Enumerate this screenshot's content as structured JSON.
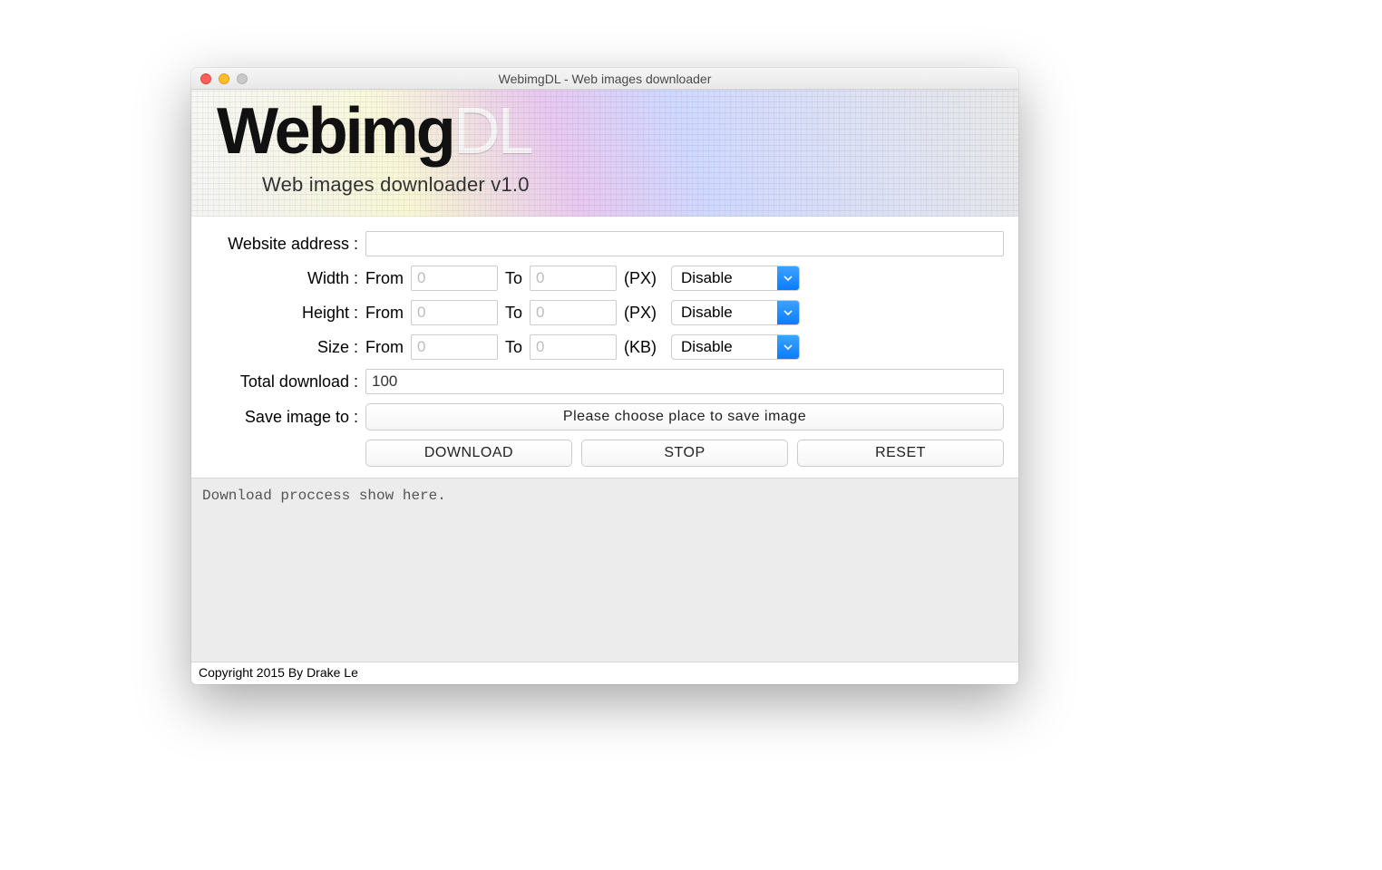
{
  "window": {
    "title": "WebimgDL - Web images downloader"
  },
  "banner": {
    "logo_main": "Webimg",
    "logo_suffix": "DL",
    "subtitle": "Web images downloader v1.0"
  },
  "form": {
    "website_label": "Website address :",
    "website_value": "",
    "width": {
      "label": "Width :",
      "from_label": "From",
      "from_placeholder": "0",
      "from_value": "",
      "to_label": "To",
      "to_placeholder": "0",
      "to_value": "",
      "unit": "(PX)",
      "select": "Disable"
    },
    "height": {
      "label": "Height :",
      "from_label": "From",
      "from_placeholder": "0",
      "from_value": "",
      "to_label": "To",
      "to_placeholder": "0",
      "to_value": "",
      "unit": "(PX)",
      "select": "Disable"
    },
    "size": {
      "label": "Size :",
      "from_label": "From",
      "from_placeholder": "0",
      "from_value": "",
      "to_label": "To",
      "to_placeholder": "0",
      "to_value": "",
      "unit": "(KB)",
      "select": "Disable"
    },
    "total_label": "Total download :",
    "total_value": "100",
    "save_label": "Save image to :",
    "save_button": "Please choose place to save image",
    "download_button": "DOWNLOAD",
    "stop_button": "STOP",
    "reset_button": "RESET"
  },
  "log": {
    "text": "Download proccess show here."
  },
  "footer": {
    "copyright": "Copyright 2015 By Drake Le"
  }
}
